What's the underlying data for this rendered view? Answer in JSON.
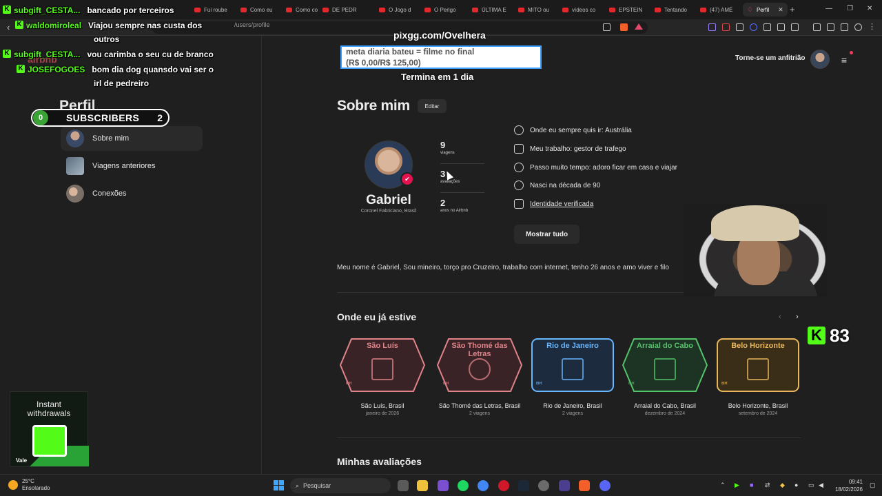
{
  "browser": {
    "tabs": [
      {
        "label": "Fui roube"
      },
      {
        "label": "Como eu"
      },
      {
        "label": "Como co"
      },
      {
        "label": "DE PEDR"
      },
      {
        "label": "O Jogo d"
      },
      {
        "label": "O Perigo"
      },
      {
        "label": "ÚLTIMA E"
      },
      {
        "label": "MITO ou"
      },
      {
        "label": "vídeos co"
      },
      {
        "label": "EPSTEIN"
      },
      {
        "label": "Tentando"
      },
      {
        "label": "(47) AMÉ"
      }
    ],
    "active_tab": {
      "label": "Perfil"
    },
    "url_suffix": "/users/profile",
    "close_glyph": "✕",
    "new_tab_glyph": "+"
  },
  "airbnb": {
    "logo_text": "airbnb",
    "host_link": "Torne-se um anfitrião",
    "menu_glyph": "≡",
    "sidebar": {
      "title": "Perfil",
      "items": [
        {
          "label": "Sobre mim"
        },
        {
          "label": "Viagens anteriores"
        },
        {
          "label": "Conexões"
        }
      ]
    },
    "about": {
      "title": "Sobre mim",
      "edit_label": "Editar",
      "name": "Gabriel",
      "location": "Coronel Fabriciano, Brasil",
      "stats": [
        {
          "value": "9",
          "label": "viagens"
        },
        {
          "value": "3",
          "label": "avaliações"
        },
        {
          "value": "2",
          "label": "anos no Airbnb"
        }
      ],
      "facts": [
        {
          "icon": "globe-pin-icon",
          "text": "Onde eu sempre quis ir: Austrália"
        },
        {
          "icon": "briefcase-icon",
          "text": "Meu trabalho: gestor de trafego"
        },
        {
          "icon": "clock-icon",
          "text": "Passo muito tempo: adoro ficar em casa e viajar"
        },
        {
          "icon": "balloon-icon",
          "text": "Nasci na década de 90"
        },
        {
          "icon": "shield-check-icon",
          "text": "Identidade verificada"
        }
      ],
      "show_all_label": "Mostrar tudo",
      "bio": "Meu nome é Gabriel,  Sou mineiro, torço pro Cruzeiro, trabalho com internet, tenho 26 anos e amo viver e filo"
    },
    "visited": {
      "title": "Onde eu já estive",
      "prev_glyph": "‹",
      "next_glyph": "›",
      "places": [
        {
          "badge": "São Luís",
          "country": "BR",
          "name": "São Luís, Brasil",
          "sub": "janeiro de 2026",
          "color": "#e0848a",
          "fill": "#3a2326",
          "shape": "hex"
        },
        {
          "badge": "São Thomé das Letras",
          "country": "BR",
          "name": "São Thomé das Letras, Brasil",
          "sub": "2 viagens",
          "color": "#e0848a",
          "fill": "#3a2326",
          "shape": "hex"
        },
        {
          "badge": "Rio de Janeiro",
          "country": "BR",
          "name": "Rio de Janeiro, Brasil",
          "sub": "2 viagens",
          "color": "#69b7ff",
          "fill": "#1c2b3d",
          "shape": "rect"
        },
        {
          "badge": "Arraial do Cabo",
          "country": "BR",
          "name": "Arraial do Cabo, Brasil",
          "sub": "dezembro de 2024",
          "color": "#54c46a",
          "fill": "#1d3323",
          "shape": "hex"
        },
        {
          "badge": "Belo Horizonte",
          "country": "BR",
          "name": "Belo Horizonte, Brasil",
          "sub": "setembro de 2024",
          "color": "#e8b75c",
          "fill": "#3a2e18",
          "shape": "rect"
        }
      ]
    },
    "reviews_title": "Minhas avaliações"
  },
  "stream": {
    "chat": [
      {
        "user": "subgift_CESTA...",
        "msg": "bancado por terceiros"
      },
      {
        "user": "waldomiroleal",
        "msg": "Viajou sempre nas custa dos"
      },
      {
        "user": "",
        "msg": "outros"
      },
      {
        "user": "subgift_CESTA...",
        "msg": "vou carimba o seu cu de branco"
      },
      {
        "user": "JOSEFOGOES",
        "msg": "bom dia dog quansdo vai ser o"
      },
      {
        "user": "",
        "msg": "irl de pedreiro"
      }
    ],
    "goal": {
      "site": "pixgg.com/Ovelhera",
      "line1": "meta diaria bateu = filme no final",
      "line2": "(R$ 0,00/R$ 125,00)",
      "ends": "Termina em 1 dia",
      "progress_fraction": 0.0
    },
    "subs": {
      "current": "0",
      "label": "SUBSCRIBERS",
      "goal": "2"
    },
    "viewers": "83",
    "ad": {
      "line1": "Instant",
      "line2": "withdrawals",
      "brand": "Vale"
    },
    "kick_glyph": "K"
  },
  "taskbar": {
    "weather_temp": "25°C",
    "weather_desc": "Ensolarado",
    "search_placeholder": "Pesquisar",
    "time": "09:41",
    "date": "18/02/2026"
  }
}
